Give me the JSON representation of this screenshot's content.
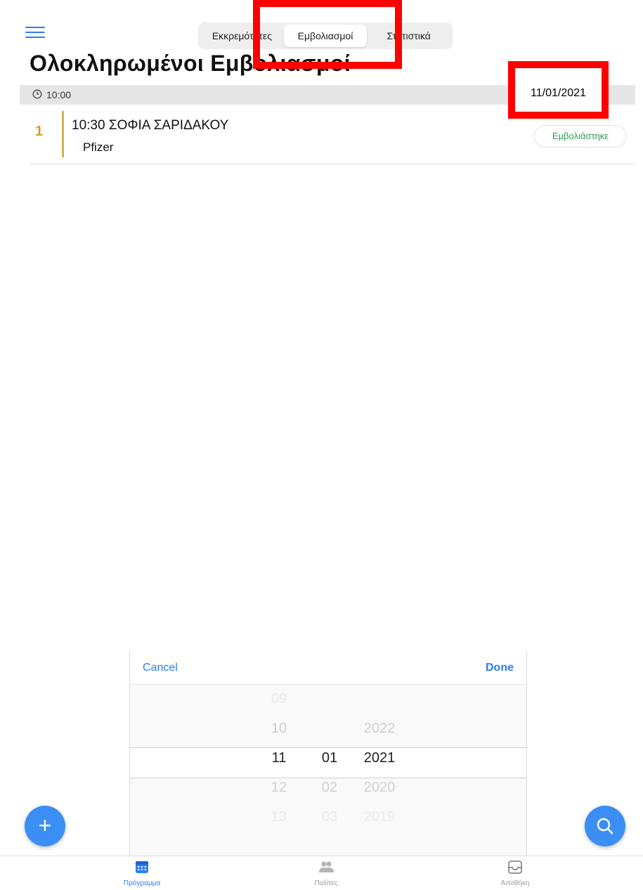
{
  "header": {
    "menu_icon": "hamburger-icon",
    "tabs": [
      {
        "label": "Εκκρεμότητες",
        "active": false
      },
      {
        "label": "Εμβολιασμοί",
        "active": true
      },
      {
        "label": "Στατιστικά",
        "active": false
      }
    ],
    "title": "Ολοκληρωμένοι Εμβολιασμοί"
  },
  "section": {
    "time": "10:00",
    "date_overlay": "11/01/2021"
  },
  "entries": [
    {
      "index": "1",
      "name": "10:30 ΣΟΦΙΑ ΣΑΡΙΔΑΚΟΥ",
      "vaccine": "Pfizer",
      "status": "Εμβολιάστηκε"
    }
  ],
  "picker": {
    "cancel_label": "Cancel",
    "done_label": "Done",
    "days": [
      "09",
      "10",
      "11",
      "12",
      "13"
    ],
    "months": [
      "",
      "",
      "01",
      "02",
      "03"
    ],
    "years": [
      "",
      "2022",
      "2021",
      "2020",
      "2019"
    ],
    "selected": {
      "day": "11",
      "month": "01",
      "year": "2021"
    }
  },
  "fabs": {
    "add_label": "+",
    "search_icon": "search-icon"
  },
  "tabbar": [
    {
      "label": "Πρόγραμμα",
      "icon": "calendar-icon",
      "active": true
    },
    {
      "label": "Πολίτες",
      "icon": "people-icon",
      "active": false
    },
    {
      "label": "Αποθήκη",
      "icon": "inbox-icon",
      "active": false
    }
  ],
  "colors": {
    "accent": "#2d7cf6",
    "status_green": "#2e9a55",
    "entry_gold": "#d4b04a",
    "annotation_red": "#ff0000"
  }
}
